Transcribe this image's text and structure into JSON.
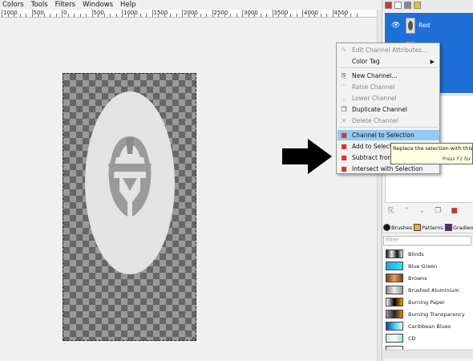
{
  "menubar": {
    "items": [
      "Colors",
      "Tools",
      "Filters",
      "Windows",
      "Help"
    ]
  },
  "ruler": {
    "labels": [
      "1000",
      "500",
      "0",
      "500",
      "1000",
      "1500",
      "2000",
      "2500",
      "3000",
      "3500",
      "4000",
      "4500"
    ]
  },
  "channels": {
    "selected": "Red",
    "rows": [
      "Red",
      ""
    ]
  },
  "context_menu": {
    "items": [
      {
        "label": "Edit Channel Attributes...",
        "icon": "edit-attributes-icon",
        "disabled": true
      },
      {
        "label": "Color Tag",
        "icon": "",
        "disabled": false,
        "submenu": true
      },
      {
        "label": "New Channel...",
        "icon": "new-channel-icon",
        "disabled": false
      },
      {
        "label": "Raise Channel",
        "icon": "raise-icon",
        "disabled": true
      },
      {
        "label": "Lower Channel",
        "icon": "lower-icon",
        "disabled": true
      },
      {
        "label": "Duplicate Channel",
        "icon": "duplicate-icon",
        "disabled": false
      },
      {
        "label": "Delete Channel",
        "icon": "delete-icon",
        "disabled": true
      },
      {
        "label": "Channel to Selection",
        "icon": "channel-to-selection-icon",
        "disabled": false,
        "highlighted": true
      },
      {
        "label": "Add to Selection",
        "icon": "add-selection-icon",
        "disabled": false
      },
      {
        "label": "Subtract from Selection",
        "icon": "subtract-selection-icon",
        "disabled": false
      },
      {
        "label": "Intersect with Selection",
        "icon": "intersect-selection-icon",
        "disabled": false
      }
    ]
  },
  "tooltip": {
    "text": "Replace the selection with this",
    "hint": "Press F1 for"
  },
  "resources": {
    "tabs": [
      "Brushes",
      "Patterns",
      "Gradients"
    ],
    "filter_placeholder": "filter",
    "gradients": [
      {
        "name": "Blinds",
        "colors": [
          "#111",
          "#eee",
          "#111",
          "#eee"
        ]
      },
      {
        "name": "Blue Green",
        "colors": [
          "#1fa4e6",
          "#36e0f0"
        ]
      },
      {
        "name": "Browns",
        "colors": [
          "#7a3d10",
          "#e0a070",
          "#7a3d10"
        ]
      },
      {
        "name": "Brushed Aluminium",
        "colors": [
          "#888",
          "#eee",
          "#999"
        ]
      },
      {
        "name": "Burning Paper",
        "colors": [
          "#ffffff",
          "#000000",
          "#f0a000"
        ]
      },
      {
        "name": "Burning Transparency",
        "colors": [
          "#999",
          "#222",
          "#f08000"
        ]
      },
      {
        "name": "Caribbean Blues",
        "colors": [
          "#1c3fa0",
          "#3ad0f0",
          "#e8f8ff"
        ]
      },
      {
        "name": "CD",
        "colors": [
          "#c0f0e0",
          "#ffffff",
          "#a0e0c0"
        ]
      },
      {
        "name": "",
        "colors": [
          "#e0e0e0",
          "#ffffff"
        ]
      }
    ]
  }
}
